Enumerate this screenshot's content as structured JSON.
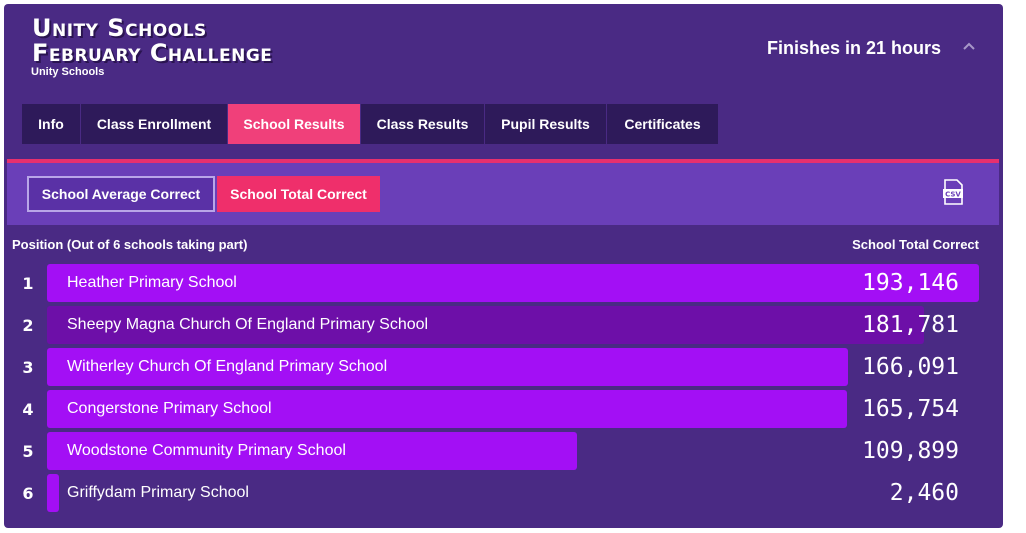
{
  "header": {
    "title_line1": "Unity Schools",
    "title_line2": "February Challenge",
    "subtitle": "Unity Schools",
    "finish_text": "Finishes in 21 hours",
    "collapse_icon": "chevron-up-icon"
  },
  "tabs": [
    {
      "label": "Info",
      "active": false
    },
    {
      "label": "Class Enrollment",
      "active": false
    },
    {
      "label": "School Results",
      "active": true
    },
    {
      "label": "Class Results",
      "active": false
    },
    {
      "label": "Pupil Results",
      "active": false
    },
    {
      "label": "Certificates",
      "active": false
    }
  ],
  "toolbar": {
    "avg_button": "School Average Correct",
    "total_button": "School Total Correct",
    "csv_icon": "csv-download-icon",
    "csv_label": "CSV"
  },
  "table": {
    "left_header": "Position (Out of 6 schools taking part)",
    "right_header": "School Total Correct",
    "max_value": 193146,
    "rows": [
      {
        "position": "1",
        "name": "Heather Primary School",
        "value": 193146,
        "display": "193,146"
      },
      {
        "position": "2",
        "name": "Sheepy Magna Church Of England Primary School",
        "value": 181781,
        "display": "181,781"
      },
      {
        "position": "3",
        "name": "Witherley Church Of England Primary School",
        "value": 166091,
        "display": "166,091"
      },
      {
        "position": "4",
        "name": "Congerstone Primary School",
        "value": 165754,
        "display": "165,754"
      },
      {
        "position": "5",
        "name": "Woodstone Community Primary School",
        "value": 109899,
        "display": "109,899"
      },
      {
        "position": "6",
        "name": "Griffydam Primary School",
        "value": 2460,
        "display": "2,460"
      }
    ]
  },
  "colors": {
    "panel_bg": "#4a2a84",
    "tab_bg": "#2e1a5a",
    "accent_pink": "#ef2f6b",
    "bar_purple": "#a30ff5",
    "bar_dark_purple": "#6d0fa8"
  }
}
